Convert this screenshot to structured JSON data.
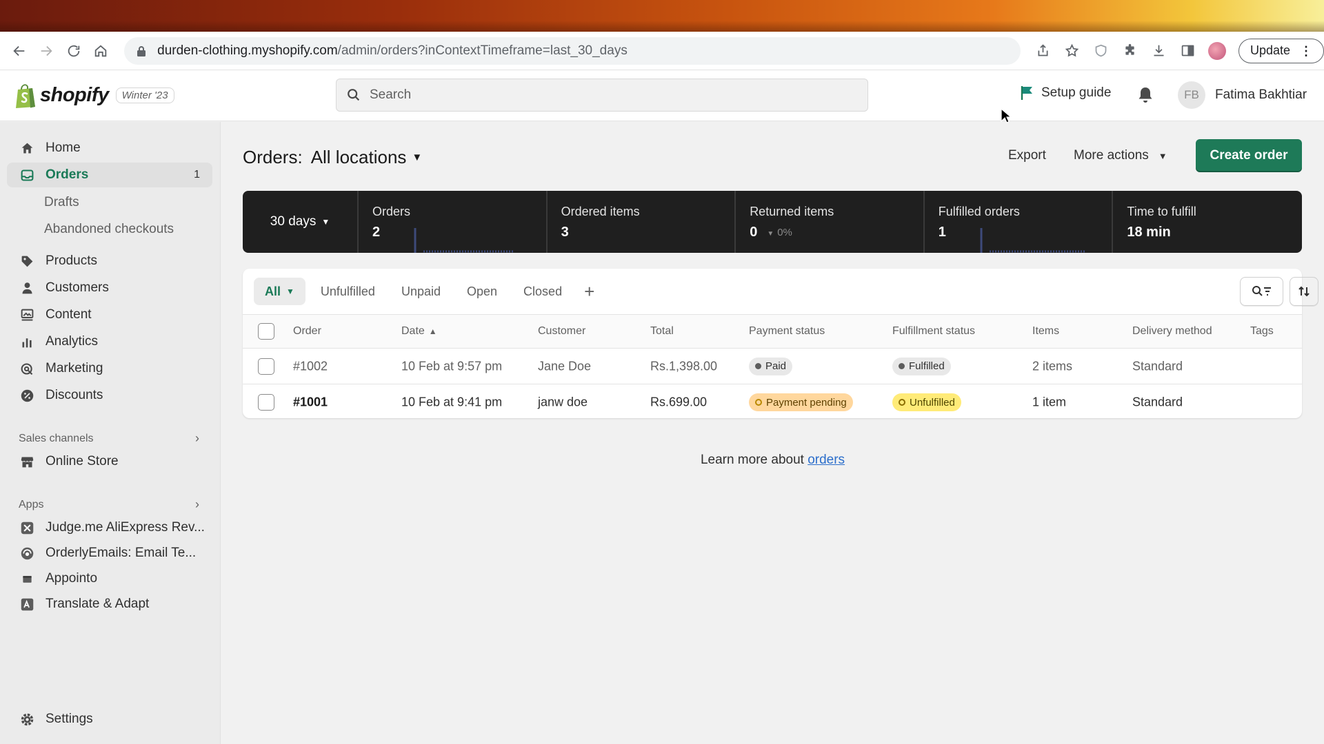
{
  "browser": {
    "url_host": "durden-clothing.myshopify.com",
    "url_path": "/admin/orders?inContextTimeframe=last_30_days",
    "update_label": "Update"
  },
  "topbar": {
    "brand": "shopify",
    "edition_badge": "Winter '23",
    "search_placeholder": "Search",
    "setup_guide": "Setup guide",
    "user_initials": "FB",
    "user_name": "Fatima Bakhtiar"
  },
  "sidebar": {
    "home": "Home",
    "orders": "Orders",
    "orders_count": "1",
    "drafts": "Drafts",
    "abandoned": "Abandoned checkouts",
    "products": "Products",
    "customers": "Customers",
    "content": "Content",
    "analytics": "Analytics",
    "marketing": "Marketing",
    "discounts": "Discounts",
    "sales_channels_label": "Sales channels",
    "online_store": "Online Store",
    "apps_label": "Apps",
    "apps": [
      "Judge.me AliExpress Rev...",
      "OrderlyEmails: Email Te...",
      "Appointo",
      "Translate & Adapt"
    ],
    "settings": "Settings"
  },
  "header": {
    "title": "Orders:",
    "location": "All locations",
    "export": "Export",
    "more_actions": "More actions",
    "create_order": "Create order"
  },
  "stats": {
    "period": "30 days",
    "items": [
      {
        "label": "Orders",
        "value": "2",
        "delta": ""
      },
      {
        "label": "Ordered items",
        "value": "3",
        "delta": ""
      },
      {
        "label": "Returned items",
        "value": "0",
        "delta": "0%"
      },
      {
        "label": "Fulfilled orders",
        "value": "1",
        "delta": ""
      },
      {
        "label": "Time to fulfill",
        "value": "18 min",
        "delta": ""
      }
    ]
  },
  "tabs": [
    "All",
    "Unfulfilled",
    "Unpaid",
    "Open",
    "Closed"
  ],
  "table": {
    "columns": [
      "Order",
      "Date",
      "Customer",
      "Total",
      "Payment status",
      "Fulfillment status",
      "Items",
      "Delivery method",
      "Tags"
    ],
    "rows": [
      {
        "order": "#1002",
        "date": "10 Feb at 9:57 pm",
        "customer": "Jane Doe",
        "total": "Rs.1,398.00",
        "payment": "Paid",
        "fulfillment": "Fulfilled",
        "items": "2 items",
        "delivery": "Standard",
        "tags": ""
      },
      {
        "order": "#1001",
        "date": "10 Feb at 9:41 pm",
        "customer": "janw doe",
        "total": "Rs.699.00",
        "payment": "Payment pending",
        "fulfillment": "Unfulfilled",
        "items": "1 item",
        "delivery": "Standard",
        "tags": ""
      }
    ]
  },
  "footer": {
    "learn_text": "Learn more about ",
    "learn_link": "orders"
  },
  "colors": {
    "primary_green": "#1e7a58",
    "active_nav": "#1a7a57",
    "stats_bg": "#1f1f1f",
    "link": "#2c6ecb"
  }
}
